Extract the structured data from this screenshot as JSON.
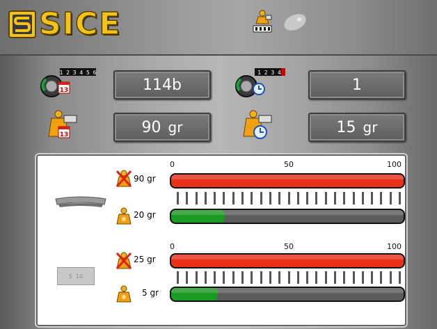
{
  "app": {
    "brand": "SICE"
  },
  "colors": {
    "brand_yellow": "#f3c318",
    "bar_red": "#e8301a",
    "bar_green": "#1a9a22",
    "bar_track": "#5c5c5c"
  },
  "header_icons": [
    {
      "name": "weights-icon",
      "active": true
    },
    {
      "name": "mouse-icon",
      "active": false
    }
  ],
  "counters": {
    "total_spins": {
      "icon": "wheel-calendar-counter-icon",
      "counter_digits": "1 2 3 4 5 6",
      "value": "114b"
    },
    "recent_spins": {
      "icon": "wheel-clock-counter-icon",
      "counter_digits": "1 2 3 4",
      "value": "1"
    },
    "total_weight": {
      "icon": "weight-calendar-icon",
      "value": "90",
      "unit": "gr"
    },
    "recent_weight": {
      "icon": "weight-clock-icon",
      "value": "15",
      "unit": "gr"
    }
  },
  "consumption": {
    "scale": {
      "min": "0",
      "mid": "50",
      "max": "100"
    },
    "groups": [
      {
        "type_icon": "clip-on-weight-icon",
        "bars": [
          {
            "label": "90 gr",
            "icon": "weight-crossed-icon",
            "level_percent": 100,
            "color": "red"
          },
          {
            "label": "20 gr",
            "icon": "weight-icon",
            "level_percent": 23,
            "color": "green"
          }
        ]
      },
      {
        "type_icon": "adhesive-weight-icon",
        "type_label": "5  10",
        "bars": [
          {
            "label": "25 gr",
            "icon": "weight-crossed-icon",
            "level_percent": 100,
            "color": "red"
          },
          {
            "label": "5 gr",
            "icon": "weight-icon",
            "level_percent": 20,
            "color": "green"
          }
        ]
      }
    ]
  }
}
